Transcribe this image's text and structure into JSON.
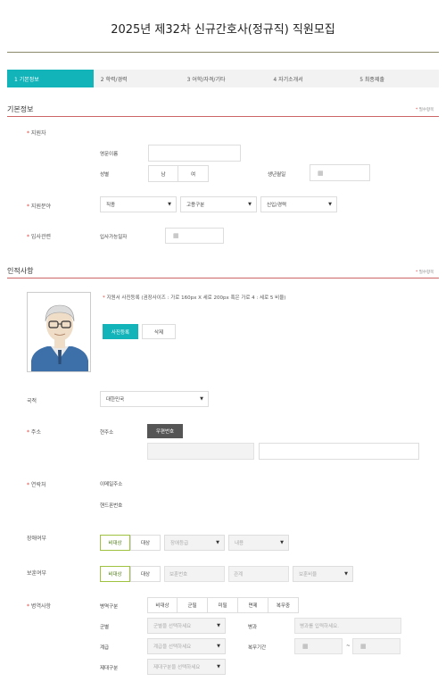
{
  "page": {
    "title": "2025년 제32차 신규간호사(정규직) 직원모집"
  },
  "steps": [
    {
      "label": "1  기본정보"
    },
    {
      "label": "2  학력/경력"
    },
    {
      "label": "3  어학/자격/기타"
    },
    {
      "label": "4  자기소개서"
    },
    {
      "label": "5  최종제출"
    }
  ],
  "required_note": "필수항목",
  "basic": {
    "section_title": "기본정보",
    "applicant_label": "지원자",
    "english_name_label": "영문이름",
    "gender_label": "성별",
    "gender_options": [
      "남",
      "여"
    ],
    "birth_label": "생년월일",
    "field_label": "지원분야",
    "job_select": "직종",
    "employment_select": "고용구분",
    "career_select": "신입/경력",
    "join_label": "입사관련",
    "join_date_label": "입사가능일자"
  },
  "personal": {
    "section_title": "인적사항",
    "photo_note": "지원서 사진등록 (권장사이즈 : 가로 160px X 세로 200px 혹은 가로 4 : 세로 5 비율)",
    "photo_register_button": "사진등록",
    "photo_delete_button": "삭제",
    "nationality_label": "국적",
    "nationality_value": "대한민국",
    "address_label": "주소",
    "current_address_label": "현주소",
    "postcode_button": "우편번호",
    "contact_label": "연락처",
    "email_label": "이메일주소",
    "phone_label": "핸드폰번호",
    "disability_label": "장애여부",
    "disability_options": [
      "비대상",
      "대상"
    ],
    "disability_grade": "장애등급",
    "disability_type": "내용",
    "veteran_label": "보훈여부",
    "veteran_options": [
      "비대상",
      "대상"
    ],
    "veteran_number": "보훈번호",
    "veteran_relation": "관계",
    "veteran_ratio": "보훈비율",
    "military_label": "병역사항",
    "military_type_label": "병역구분",
    "military_type_options": [
      "비대상",
      "군필",
      "미필",
      "면제",
      "복무중"
    ],
    "branch_label": "군별",
    "branch_placeholder": "군별을 선택하세요",
    "specialty_label": "병과",
    "specialty_placeholder": "병과를 입력하세요.",
    "rank_label": "계급",
    "rank_placeholder": "계급을 선택하세요",
    "service_period_label": "복무기간",
    "period_separator": "~",
    "discharge_label": "제대구분",
    "discharge_placeholder": "제대구분을 선택하세요"
  },
  "icons": {
    "calendar": "calendar-icon",
    "dropdown": "chevron-down-icon",
    "required": "asterisk-icon"
  },
  "colors": {
    "accent": "#12b3b9",
    "required": "#e0443c",
    "selected_border": "#9fc240"
  }
}
